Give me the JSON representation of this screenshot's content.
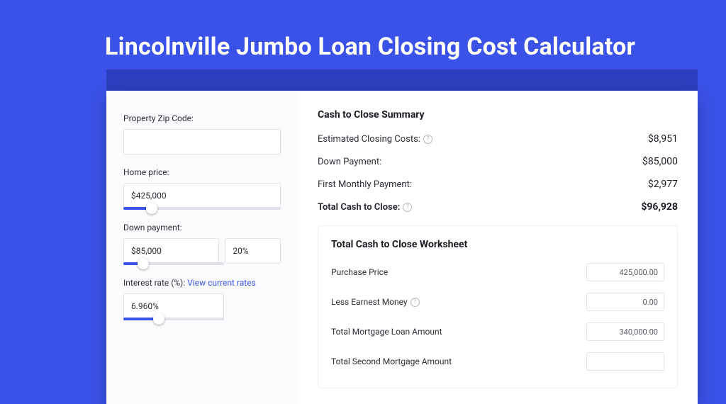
{
  "title": "Lincolnville Jumbo Loan Closing Cost Calculator",
  "form": {
    "zip": {
      "label": "Property Zip Code:",
      "value": ""
    },
    "home_price": {
      "label": "Home price:",
      "value": "$425,000",
      "slider_pct": 18
    },
    "down_payment": {
      "label": "Down payment:",
      "value": "$85,000",
      "pct": "20%",
      "slider_pct": 20
    },
    "interest": {
      "label": "Interest rate (%):",
      "link_text": "View current rates",
      "value": "6.960%",
      "slider_pct": 35
    }
  },
  "summary": {
    "heading": "Cash to Close Summary",
    "rows": [
      {
        "label": "Estimated Closing Costs:",
        "value": "$8,951",
        "help": true
      },
      {
        "label": "Down Payment:",
        "value": "$85,000",
        "help": false
      },
      {
        "label": "First Monthly Payment:",
        "value": "$2,977",
        "help": false
      }
    ],
    "total": {
      "label": "Total Cash to Close:",
      "value": "$96,928",
      "help": true
    }
  },
  "worksheet": {
    "heading": "Total Cash to Close Worksheet",
    "rows": [
      {
        "label": "Purchase Price",
        "value": "425,000.00",
        "help": false
      },
      {
        "label": "Less Earnest Money",
        "value": "0.00",
        "help": true
      },
      {
        "label": "Total Mortgage Loan Amount",
        "value": "340,000.00",
        "help": false
      },
      {
        "label": "Total Second Mortgage Amount",
        "value": "",
        "help": false
      }
    ]
  }
}
